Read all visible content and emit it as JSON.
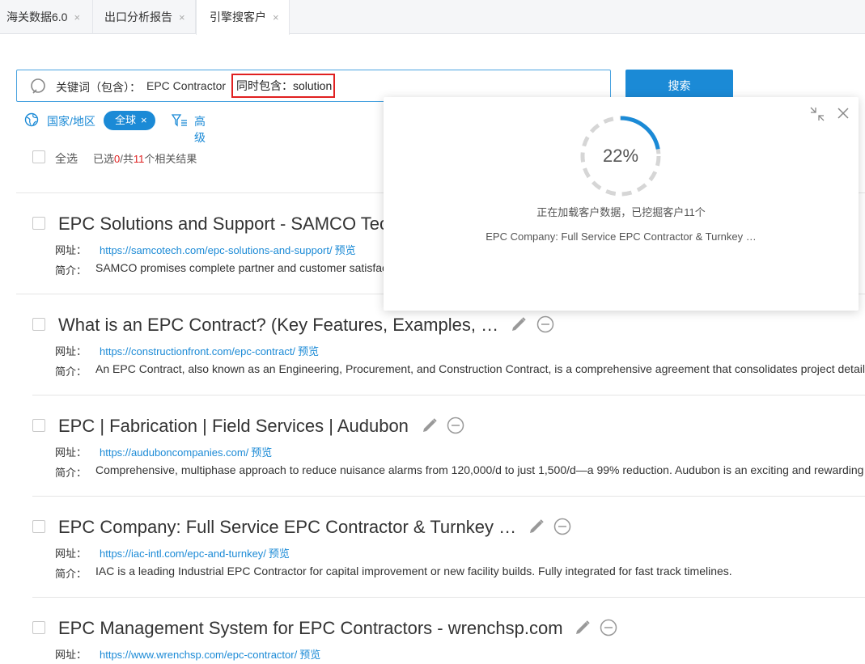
{
  "tabs": [
    {
      "label": "海关数据6.0",
      "close": "×"
    },
    {
      "label": "出口分析报告",
      "close": "×"
    },
    {
      "label": "引擎搜客户",
      "close": "×"
    }
  ],
  "search": {
    "keyword_label": "关键词（包含）：",
    "keyword_value": "EPC Contractor",
    "also_contains": "同时包含：solution",
    "button": "搜索"
  },
  "filters": {
    "region_label": "国家/地区",
    "chip": "全球",
    "chip_close": "×",
    "advanced": "高级"
  },
  "selection": {
    "select_all": "全选",
    "prefix": "已选",
    "selected": "0",
    "middle": "/共",
    "total": "11",
    "suffix": "个相关结果"
  },
  "labels": {
    "url": "网址：",
    "desc": "简介：",
    "preview": "预览"
  },
  "results": [
    {
      "title": "EPC Solutions and Support - SAMCO Tec",
      "url": "https://samcotech.com/epc-solutions-and-support/",
      "desc": "SAMCO promises complete partner and customer satisfac"
    },
    {
      "title": "What is an EPC Contract? (Key Features, Examples, …",
      "url": "https://constructionfront.com/epc-contract/",
      "desc": "An EPC Contract, also known as an Engineering, Procurement, and Construction Contract, is a comprehensive agreement that consolidates project detail"
    },
    {
      "title": "EPC | Fabrication | Field Services | Audubon",
      "url": "https://auduboncompanies.com/",
      "desc": "Comprehensive, multiphase approach to reduce nuisance alarms from 120,000/d to just 1,500/d—a 99% reduction. Audubon is an exciting and rewarding"
    },
    {
      "title": "EPC Company: Full Service EPC Contractor & Turnkey …",
      "url": "https://iac-intl.com/epc-and-turnkey/",
      "desc": "IAC is a leading Industrial EPC Contractor for capital improvement or new facility builds. Fully integrated for fast track timelines."
    },
    {
      "title": "EPC Management System for EPC Contractors - wrenchsp.com",
      "url": "https://www.wrenchsp.com/epc-contractor/",
      "desc": ""
    }
  ],
  "loading": {
    "progress": 22,
    "progress_text": "22%",
    "status": "正在加载客户数据，已挖掘客户11个",
    "current_item": "EPC Company: Full Service EPC Contractor & Turnkey …"
  },
  "colors": {
    "accent": "#1b8ad6",
    "highlight": "#e02020"
  }
}
